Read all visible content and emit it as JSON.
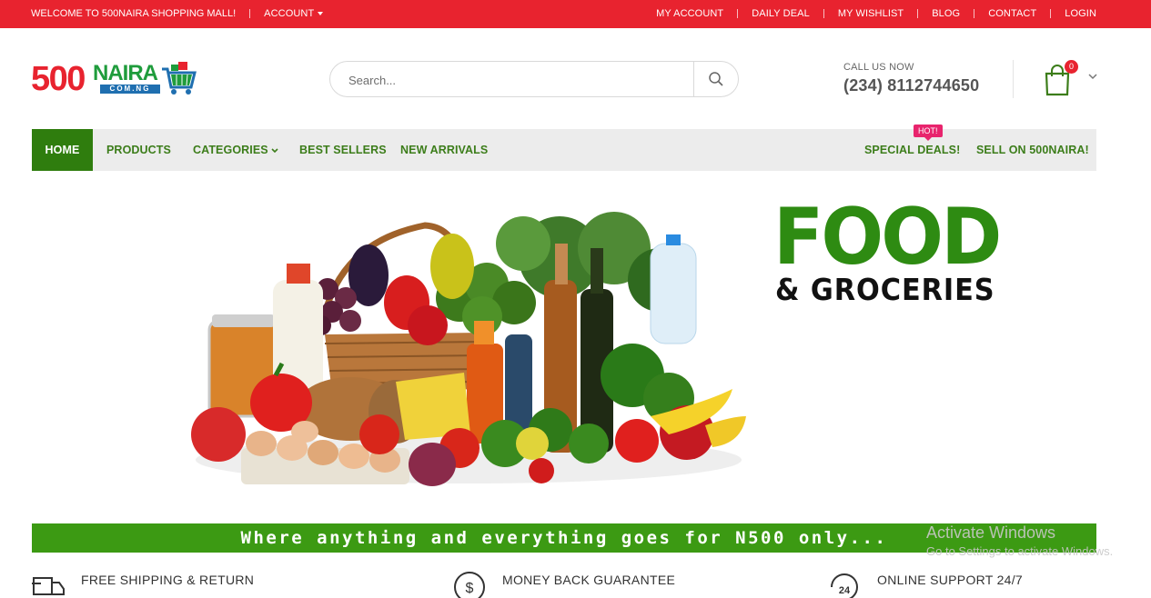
{
  "topbar": {
    "welcome": "WELCOME TO 500NAIRA SHOPPING MALL!",
    "account": "ACCOUNT",
    "links": [
      "MY ACCOUNT",
      "DAILY DEAL",
      "MY WISHLIST",
      "BLOG",
      "CONTACT",
      "LOGIN"
    ]
  },
  "logo": {
    "num": "500",
    "naira": "NAIRA",
    "domain": "COM.NG"
  },
  "search": {
    "placeholder": "Search..."
  },
  "contact": {
    "label": "CALL US NOW",
    "phone": "(234) 8112744650"
  },
  "cart": {
    "count": "0"
  },
  "nav": {
    "home": "HOME",
    "products": "PRODUCTS",
    "categories": "CATEGORIES",
    "best_sellers": "BEST SELLERS",
    "new_arrivals": "NEW ARRIVALS",
    "special_deals": "SPECIAL DEALS!",
    "hot_badge": "HOT!",
    "sell": "SELL ON 500NAIRA!"
  },
  "banner": {
    "title": "FOOD",
    "subtitle": "& GROCERIES",
    "tagline": "Where anything and everything goes for N500 only..."
  },
  "windows_watermark": {
    "line1": "Activate Windows",
    "line2": "Go to Settings to activate Windows."
  },
  "features": [
    {
      "title": "FREE SHIPPING & RETURN",
      "icon": "truck-icon"
    },
    {
      "title": "MONEY BACK GUARANTEE",
      "icon": "dollar-icon"
    },
    {
      "title": "ONLINE SUPPORT 24/7",
      "icon": "support-24-icon"
    }
  ],
  "colors": {
    "brand_red": "#e8232f",
    "brand_green": "#2f7d0e",
    "tagline_green": "#3c9a13",
    "hot_pink": "#e8246d"
  }
}
